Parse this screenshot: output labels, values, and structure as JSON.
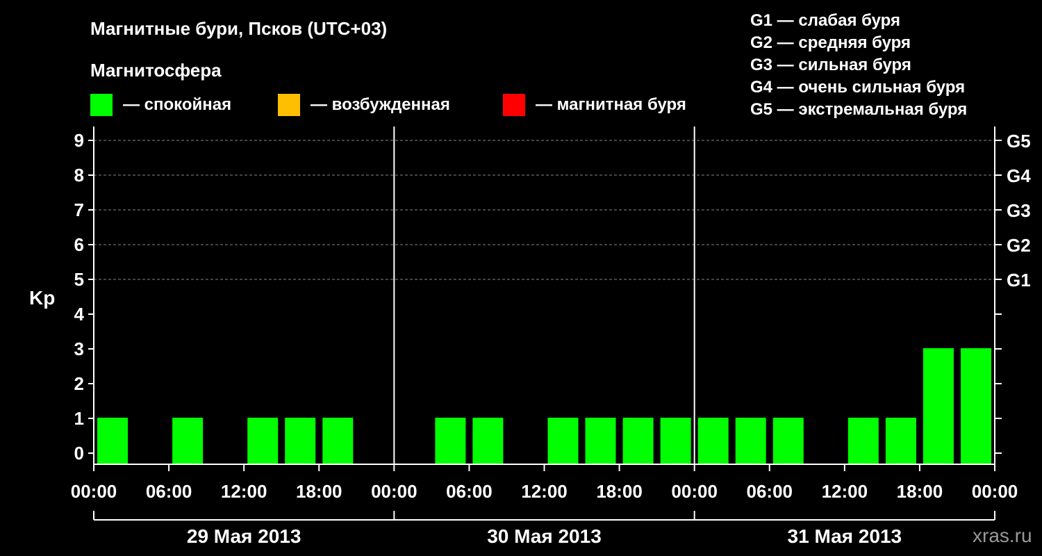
{
  "chart_data": {
    "type": "bar",
    "title": "Магнитные бури, Псков (UTC+03)",
    "subtitle": "Магнитосфера",
    "ylabel": "Kp",
    "ylim": [
      0,
      9
    ],
    "yticks": [
      "0",
      "1",
      "2",
      "3",
      "4",
      "5",
      "6",
      "7",
      "8",
      "9"
    ],
    "right_axis_labels": [
      {
        "kp": 5,
        "label": "G1"
      },
      {
        "kp": 6,
        "label": "G2"
      },
      {
        "kp": 7,
        "label": "G3"
      },
      {
        "kp": 8,
        "label": "G4"
      },
      {
        "kp": 9,
        "label": "G5"
      }
    ],
    "grid": "dashed horizontal at Kp 5–9",
    "status_legend": [
      {
        "color": "#00ff00",
        "label": "— спокойная"
      },
      {
        "color": "#ffbf00",
        "label": "— возбужденная"
      },
      {
        "color": "#ff0000",
        "label": "— магнитная буря"
      }
    ],
    "g_legend": [
      "G1 — слабая буря",
      "G2 — средняя буря",
      "G3 — сильная буря",
      "G4 — очень сильная буря",
      "G5 — экстремальная буря"
    ],
    "x_tick_labels": [
      "00:00",
      "06:00",
      "12:00",
      "18:00",
      "00:00",
      "06:00",
      "12:00",
      "18:00",
      "00:00",
      "06:00",
      "12:00",
      "18:00",
      "00:00"
    ],
    "days": [
      "29 Мая 2013",
      "30 Мая 2013",
      "31 Мая 2013"
    ],
    "series": [
      {
        "values": [
          1,
          0,
          1,
          0,
          1,
          1,
          1,
          0,
          0,
          1,
          1,
          0,
          1,
          1,
          1,
          1,
          1,
          1,
          1,
          0,
          1,
          1,
          3,
          3
        ]
      }
    ],
    "bar_color": "#00ff00"
  },
  "watermark": "xras.ru"
}
